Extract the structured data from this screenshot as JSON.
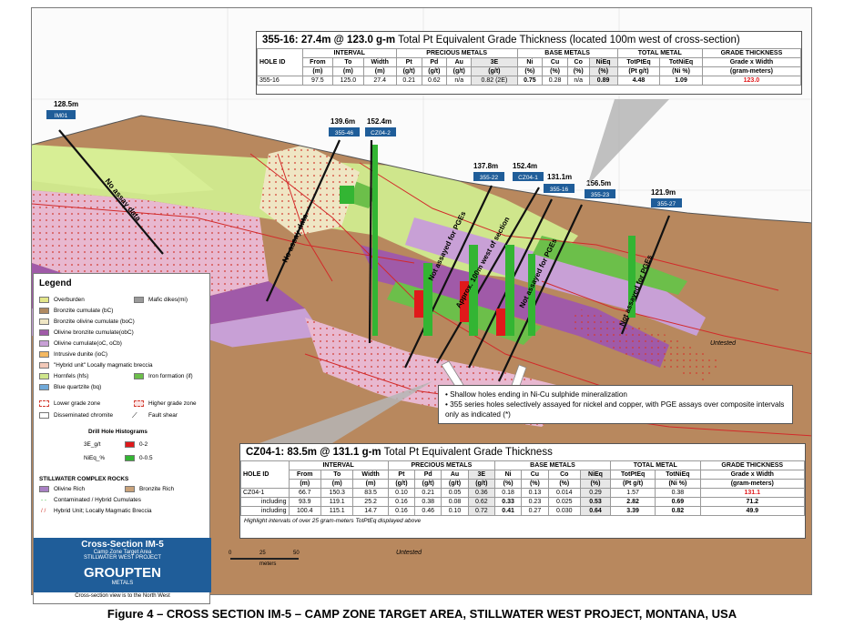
{
  "figure_caption": "Figure 4 –  CROSS SECTION IM-5 – CAMP ZONE TARGET AREA, STILLWATER WEST PROJECT, MONTANA, USA",
  "collars": [
    {
      "hole": "IM01",
      "elevation": "128.5m"
    },
    {
      "hole": "355-46",
      "elevation": "139.6m"
    },
    {
      "hole": "CZ04-2",
      "elevation": "152.4m"
    },
    {
      "hole": "355-22",
      "elevation": "137.8m"
    },
    {
      "hole": "CZ04-1",
      "elevation": "152.4m"
    },
    {
      "hole": "355-16",
      "elevation": "131.1m"
    },
    {
      "hole": "355-23",
      "elevation": "156.5m"
    },
    {
      "hole": "355-27",
      "elevation": "121.9m"
    }
  ],
  "hole_annotations": {
    "no_assay_1": "No assay data",
    "no_assay_2": "No assay data",
    "not_assayed_1": "Not assayed for PGEs",
    "approx": "Approx. 100m west of section",
    "not_assayed_2": "Not assayed for PGEs",
    "not_assayed_3": "Not assayed for PGEs",
    "untested_right": "Untested",
    "untested_bottom": "Untested"
  },
  "panel_top": {
    "hole": "355-16:",
    "headline": "27.4m @ 123.0 g-m",
    "subtitle": "Total Pt Equivalent Grade Thickness (located 100m west of cross-section)",
    "group_headers": [
      "INTERVAL",
      "PRECIOUS METALS",
      "BASE METALS",
      "TOTAL METAL",
      "GRADE THICKNESS"
    ],
    "columns": [
      "HOLE ID",
      "From",
      "To",
      "Width",
      "Pt",
      "Pd",
      "Au",
      "3E",
      "Ni",
      "Cu",
      "Co",
      "NiEq",
      "TotPtEq",
      "TotNiEq",
      "Grade x Width"
    ],
    "units": [
      "",
      "(m)",
      "(m)",
      "(m)",
      "(g/t)",
      "(g/t)",
      "(g/t)",
      "(g/t)",
      "(%)",
      "(%)",
      "(%)",
      "(%)",
      "(Pt g/t)",
      "(Ni %)",
      "(gram-meters)"
    ],
    "rows": [
      [
        "355-16",
        "97.5",
        "125.0",
        "27.4",
        "0.21",
        "0.62",
        "n/a",
        "0.82 (2E)",
        "0.75",
        "0.28",
        "n/a",
        "0.89",
        "4.48",
        "1.09",
        "123.0"
      ]
    ]
  },
  "panel_bottom": {
    "hole": "CZ04-1:",
    "headline": "83.5m @ 131.1 g-m",
    "subtitle": "Total Pt Equivalent Grade Thickness",
    "group_headers": [
      "INTERVAL",
      "PRECIOUS METALS",
      "BASE METALS",
      "TOTAL METAL",
      "GRADE THICKNESS"
    ],
    "columns": [
      "HOLE ID",
      "From",
      "To",
      "Width",
      "Pt",
      "Pd",
      "Au",
      "3E",
      "Ni",
      "Cu",
      "Co",
      "NiEq",
      "TotPtEq",
      "TotNiEq",
      "Grade x Width"
    ],
    "units": [
      "",
      "(m)",
      "(m)",
      "(m)",
      "(g/t)",
      "(g/t)",
      "(g/t)",
      "(g/t)",
      "(%)",
      "(%)",
      "(%)",
      "(%)",
      "(Pt g/t)",
      "(Ni %)",
      "(gram-meters)"
    ],
    "rows": [
      [
        "CZ04-1",
        "66.7",
        "150.3",
        "83.5",
        "0.10",
        "0.21",
        "0.05",
        "0.36",
        "0.18",
        "0.13",
        "0.014",
        "0.29",
        "1.57",
        "0.38",
        "131.1"
      ],
      [
        "including",
        "93.9",
        "119.1",
        "25.2",
        "0.16",
        "0.38",
        "0.08",
        "0.62",
        "0.33",
        "0.23",
        "0.025",
        "0.53",
        "2.82",
        "0.69",
        "71.2"
      ],
      [
        "including",
        "100.4",
        "115.1",
        "14.7",
        "0.16",
        "0.46",
        "0.10",
        "0.72",
        "0.41",
        "0.27",
        "0.030",
        "0.64",
        "3.39",
        "0.82",
        "49.9"
      ]
    ],
    "footnote": "Highlight intervals of over 25 gram-meters TotPtEq displayed above"
  },
  "callout": {
    "bullet_1": "Shallow holes ending in Ni-Cu sulphide mineralization",
    "bullet_2": "355 series holes selectively assayed for nickel and copper, with PGE assays over composite intervals only as indicated (*)"
  },
  "legend": {
    "title": "Legend",
    "units": [
      {
        "label": "Overburden",
        "color": "#e3e68a"
      },
      {
        "label": "Bronzite cumulate (bC)",
        "color": "#b08a62"
      },
      {
        "label": "Bronzite olivine cumulate (boC)",
        "color": "#efe6c4"
      },
      {
        "label": "Olivine bronzite cumulate(obC)",
        "color": "#a05aa8"
      },
      {
        "label": "Olivine cumulate(oC, oCb)",
        "color": "#c8a0d6"
      },
      {
        "label": "Intrusive dunite (ioC)",
        "color": "#f4b860"
      },
      {
        "label": "\"Hybrid unit\" Locally magmatic breccia",
        "color": "#f2c8b8"
      },
      {
        "label": "Hornfels (hfs)",
        "color": "#cfe68c"
      },
      {
        "label": "Blue quartzite (bq)",
        "color": "#6fa9d9"
      }
    ],
    "units_right": [
      {
        "label": "Mafic dikes(mi)",
        "color": "#9a9a9a"
      },
      {
        "label": "Iron formation (if)",
        "color": "#6cbf4a"
      }
    ],
    "symbols": [
      "Lower grade zone",
      "Higher grade zone",
      "Disseminated chromite",
      "Fault shear"
    ],
    "histogram_title": "Drill Hole Histograms",
    "histograms": [
      {
        "label": "3E_g/t",
        "range": "0-2",
        "color": "#e0191b"
      },
      {
        "label": "NiEq_%",
        "range": "0-0.5",
        "color": "#33b533"
      }
    ],
    "complex_title": "STILLWATER COMPLEX ROCKS",
    "complex": [
      {
        "label": "Olivine Rich",
        "color": "#a980c4"
      },
      {
        "label": "Bronzite Rich",
        "color": "#c9a27a"
      }
    ],
    "complex_lines": [
      "Contaminated / Hybrid Cumulates",
      "Hybrid Unit; Locally Magmatic Breccia"
    ],
    "section_title": "Cross-Section IM-5",
    "section_sub_1": "Camp Zone Target Area",
    "section_sub_2": "STILLWATER WEST PROJECT",
    "logo_text": "GROUPTEN",
    "logo_sub": "METALS",
    "scale_ticks": [
      "0",
      "25",
      "50"
    ],
    "scale_unit": "meters",
    "view_note": "Cross-section view is to the North West"
  }
}
